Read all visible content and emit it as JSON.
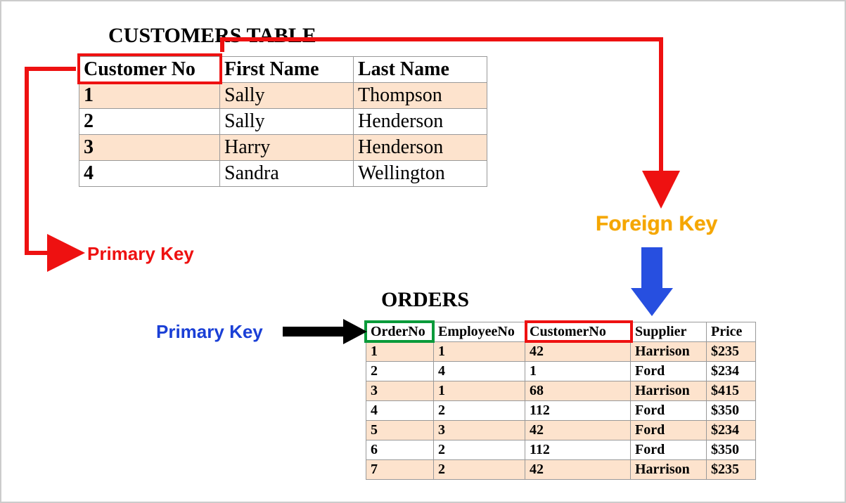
{
  "titles": {
    "customers": "CUSTOMERS TABLE",
    "orders": "ORDERS"
  },
  "labels": {
    "primary_key_customers": "Primary Key",
    "foreign_key": "Foreign Key",
    "primary_key_orders": "Primary Key"
  },
  "colors": {
    "primary_key_red": "#e11",
    "foreign_key_yellow": "#f5a600",
    "primary_key_blue_label": "#1a3fd6",
    "pk_box_green": "#0a9a3a",
    "blue_arrow": "#274fe0",
    "row_shade": "#fde3cd"
  },
  "customers": {
    "headers": {
      "customer_no": "Customer No",
      "first_name": "First Name",
      "last_name": "Last Name"
    },
    "rows": [
      {
        "no": "1",
        "first": "Sally",
        "last": "Thompson"
      },
      {
        "no": "2",
        "first": "Sally",
        "last": "Henderson"
      },
      {
        "no": "3",
        "first": "Harry",
        "last": "Henderson"
      },
      {
        "no": "4",
        "first": "Sandra",
        "last": "Wellington"
      }
    ]
  },
  "orders": {
    "headers": {
      "order_no": "OrderNo",
      "employee_no": "EmployeeNo",
      "customer_no": "CustomerNo",
      "supplier": "Supplier",
      "price": "Price"
    },
    "rows": [
      {
        "order": "1",
        "emp": "1",
        "cust": "42",
        "supplier": "Harrison",
        "price": "$235"
      },
      {
        "order": "2",
        "emp": "4",
        "cust": "1",
        "supplier": "Ford",
        "price": "$234"
      },
      {
        "order": "3",
        "emp": "1",
        "cust": "68",
        "supplier": "Harrison",
        "price": "$415"
      },
      {
        "order": "4",
        "emp": "2",
        "cust": "112",
        "supplier": "Ford",
        "price": "$350"
      },
      {
        "order": "5",
        "emp": "3",
        "cust": "42",
        "supplier": "Ford",
        "price": "$234"
      },
      {
        "order": "6",
        "emp": "2",
        "cust": "112",
        "supplier": "Ford",
        "price": "$350"
      },
      {
        "order": "7",
        "emp": "2",
        "cust": "42",
        "supplier": "Harrison",
        "price": "$235"
      }
    ]
  }
}
